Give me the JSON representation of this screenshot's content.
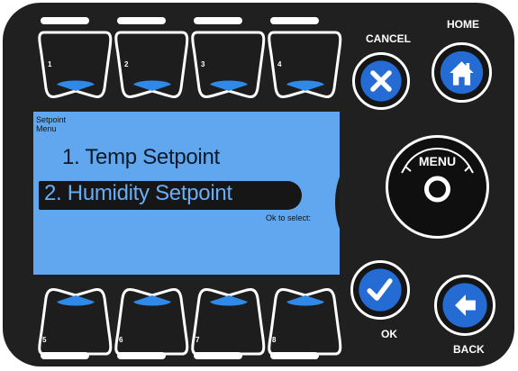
{
  "device": {
    "name": "thermostat-control-panel"
  },
  "soft_keys": {
    "top": [
      {
        "number": "1"
      },
      {
        "number": "2"
      },
      {
        "number": "3"
      },
      {
        "number": "4"
      }
    ],
    "bottom": [
      {
        "number": "5"
      },
      {
        "number": "6"
      },
      {
        "number": "7"
      },
      {
        "number": "8"
      }
    ]
  },
  "screen": {
    "title_line_1": "Setpoint",
    "title_line_2": "Menu",
    "option_1": "1. Temp Setpoint",
    "option_2": "2. Humidity Setpoint",
    "hint": "Ok to select:"
  },
  "buttons": {
    "cancel": {
      "label": "CANCEL",
      "icon": "x-icon"
    },
    "home": {
      "label": "HOME",
      "icon": "house-icon"
    },
    "menu": {
      "label": "MENU",
      "icon": "rotary-knob-icon"
    },
    "ok": {
      "label": "OK",
      "icon": "checkmark-icon"
    },
    "back": {
      "label": "BACK",
      "icon": "back-arrow-icon"
    }
  },
  "colors": {
    "panel": "#202020",
    "screen": "#61a7f0",
    "button_fill": "#246bd3",
    "highlight": "#161616",
    "white": "#ffffff"
  }
}
